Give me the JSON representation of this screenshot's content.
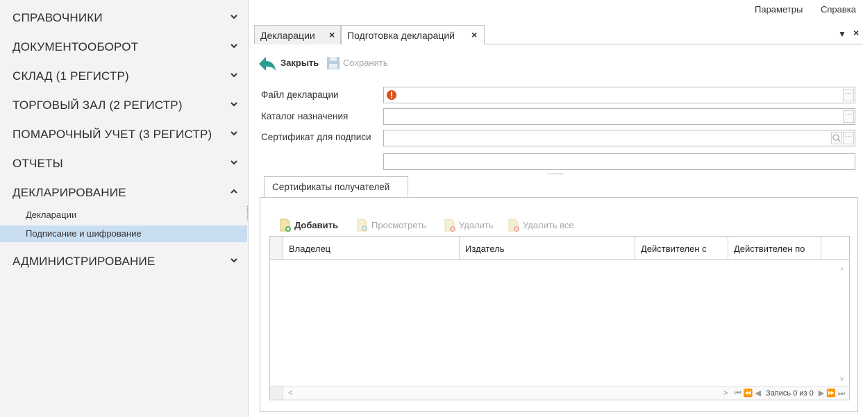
{
  "sidebar": {
    "sections": [
      {
        "label": "СПРАВОЧНИКИ",
        "expanded": false
      },
      {
        "label": "ДОКУМЕНТООБОРОТ",
        "expanded": false
      },
      {
        "label": "СКЛАД (1 РЕГИСТР)",
        "expanded": false
      },
      {
        "label": "ТОРГОВЫЙ ЗАЛ (2 РЕГИСТР)",
        "expanded": false
      },
      {
        "label": "ПОМАРОЧНЫЙ УЧЕТ (3 РЕГИСТР)",
        "expanded": false
      },
      {
        "label": "ОТЧЕТЫ",
        "expanded": false
      },
      {
        "label": "ДЕКЛАРИРОВАНИЕ",
        "expanded": true
      },
      {
        "label": "АДМИНИСТРИРОВАНИЕ",
        "expanded": false
      }
    ],
    "sub_items": [
      {
        "label": "Декларации",
        "active": false
      },
      {
        "label": "Подписание и шифрование",
        "active": true
      }
    ]
  },
  "top_menu": {
    "params": "Параметры",
    "help": "Справка"
  },
  "tabs": [
    {
      "label": "Декларации",
      "close": "×"
    },
    {
      "label": "Подготовка деклараций",
      "close": "×"
    }
  ],
  "tab_controls": {
    "dropdown": "▼",
    "close": "×"
  },
  "toolbar": {
    "close_label": "Закрыть",
    "save_label": "Сохранить"
  },
  "form": {
    "file_label": "Файл декларации",
    "dir_label": "Каталог назначения",
    "cert_label": "Сертификат для подписи",
    "file_value": "",
    "dir_value": "",
    "cert_value": "",
    "extra_value": "",
    "ellipsis": "···"
  },
  "inner_tab": {
    "label": "Сертификаты получателей"
  },
  "inner_toolbar": {
    "add": "Добавить",
    "view": "Просмотреть",
    "delete": "Удалить",
    "delete_all": "Удалить все"
  },
  "grid": {
    "columns": [
      "Владелец",
      "Издатель",
      "Действителен с",
      "Действителен по"
    ],
    "rows": [],
    "pager_text": "Запись 0 из 0"
  },
  "colors": {
    "accent": "#2a9d8f",
    "selected": "#c9def1",
    "error": "#d9531e",
    "disabled": "#a8a8a8"
  }
}
